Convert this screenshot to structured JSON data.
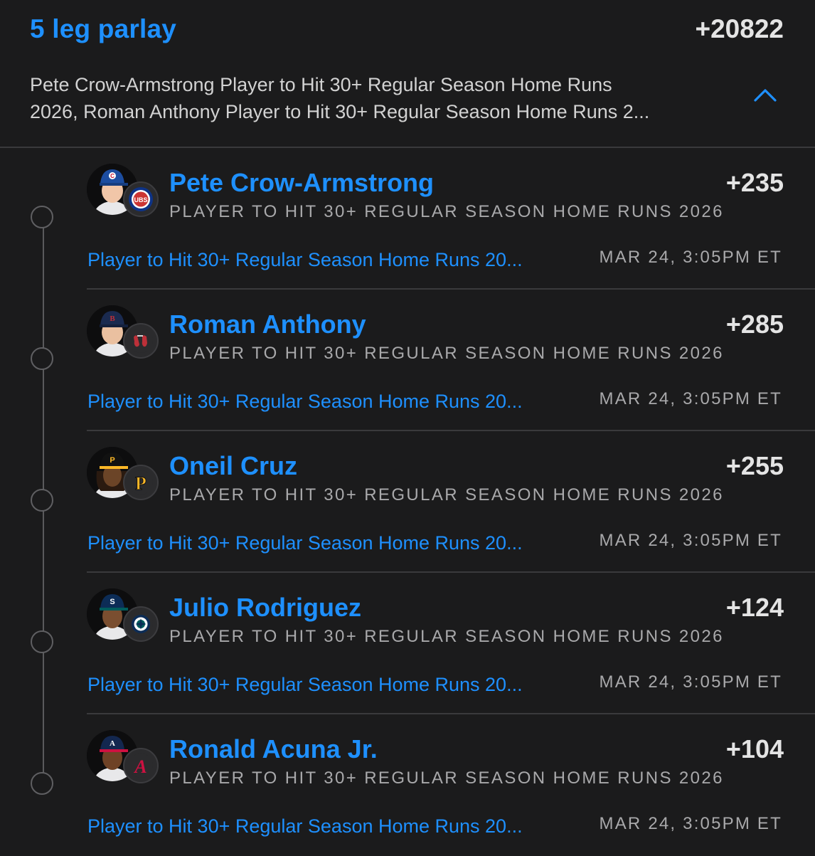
{
  "parlay": {
    "title": "5 leg parlay",
    "odds": "+20822",
    "description_line1": "Pete Crow-Armstrong Player to Hit 30+ Regular Season Home Runs",
    "description_line2": "2026, Roman Anthony Player to Hit 30+ Regular Season Home Runs 2...",
    "toggle_icon": "chevron-up-icon"
  },
  "colors": {
    "accent": "#1e90ff",
    "background": "#1b1b1c",
    "muted_text": "#a9a9ab"
  },
  "legs": [
    {
      "player": "Pete Crow-Armstrong",
      "odds": "+235",
      "market": "PLAYER TO HIT 30+ REGULAR SEASON HOME RUNS 2026",
      "event": "Player to Hit 30+ Regular Season Home Runs 20...",
      "time": "MAR 24, 3:05PM ET",
      "team": "Chicago Cubs",
      "logo_text": "UBS",
      "cap_letter": "C"
    },
    {
      "player": "Roman Anthony",
      "odds": "+285",
      "market": "PLAYER TO HIT 30+ REGULAR SEASON HOME RUNS 2026",
      "event": "Player to Hit 30+ Regular Season Home Runs 20...",
      "time": "MAR 24, 3:05PM ET",
      "team": "Boston Red Sox",
      "logo_text": "",
      "cap_letter": "B"
    },
    {
      "player": "Oneil Cruz",
      "odds": "+255",
      "market": "PLAYER TO HIT 30+ REGULAR SEASON HOME RUNS 2026",
      "event": "Player to Hit 30+ Regular Season Home Runs 20...",
      "time": "MAR 24, 3:05PM ET",
      "team": "Pittsburgh Pirates",
      "logo_text": "P",
      "cap_letter": "P"
    },
    {
      "player": "Julio Rodriguez",
      "odds": "+124",
      "market": "PLAYER TO HIT 30+ REGULAR SEASON HOME RUNS 2026",
      "event": "Player to Hit 30+ Regular Season Home Runs 20...",
      "time": "MAR 24, 3:05PM ET",
      "team": "Seattle Mariners",
      "logo_text": "",
      "cap_letter": "S"
    },
    {
      "player": "Ronald Acuna Jr.",
      "odds": "+104",
      "market": "PLAYER TO HIT 30+ REGULAR SEASON HOME RUNS 2026",
      "event": "Player to Hit 30+ Regular Season Home Runs 20...",
      "time": "MAR 24, 3:05PM ET",
      "team": "Atlanta Braves",
      "logo_text": "A",
      "cap_letter": "A"
    }
  ]
}
